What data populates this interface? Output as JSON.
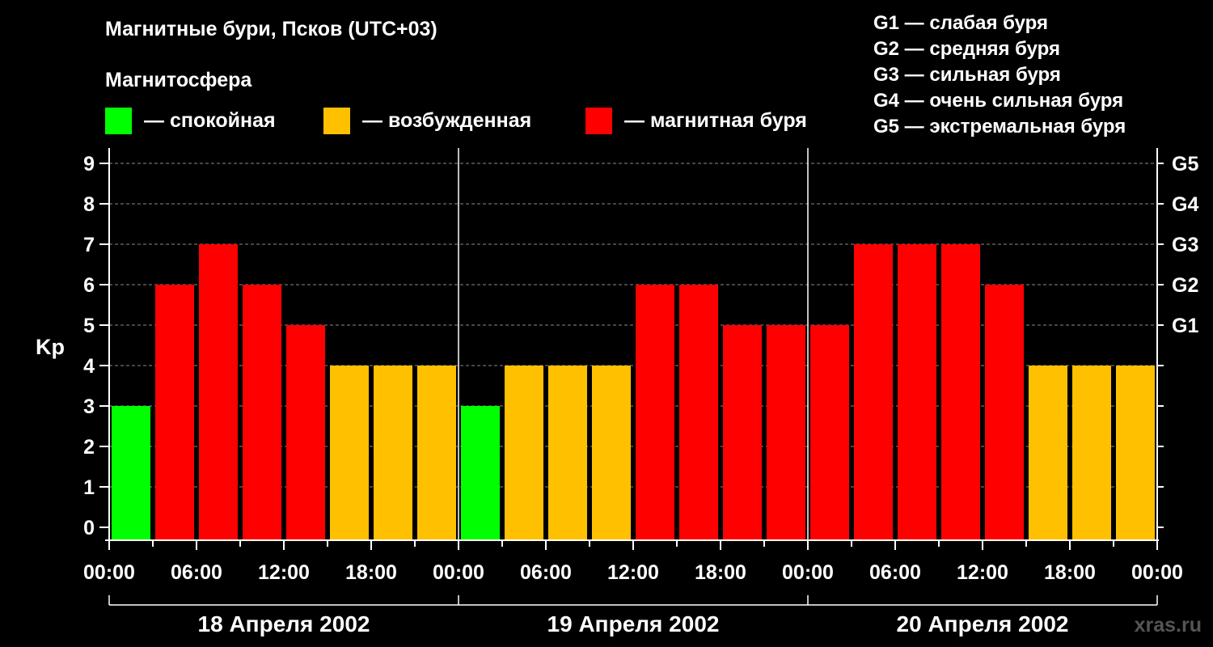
{
  "title": "Магнитные бури, Псков (UTC+03)",
  "subtitle": "Магнитосфера",
  "legend": [
    {
      "label": "— спокойная",
      "color": "#00ff00"
    },
    {
      "label": "— возбужденная",
      "color": "#ffc000"
    },
    {
      "label": "— магнитная буря",
      "color": "#ff0000"
    }
  ],
  "g_legend": [
    "G1 — слабая буря",
    "G2 — средняя буря",
    "G3 — сильная буря",
    "G4 — очень сильная буря",
    "G5 — экстремальная буря"
  ],
  "watermark": "xras.ru",
  "chart_data": {
    "type": "bar",
    "ylabel": "Kp",
    "ylim": [
      0,
      9
    ],
    "yticks": [
      0,
      1,
      2,
      3,
      4,
      5,
      6,
      7,
      8,
      9
    ],
    "right_ticks": [
      {
        "value": 5,
        "label": "G1"
      },
      {
        "value": 6,
        "label": "G2"
      },
      {
        "value": 7,
        "label": "G3"
      },
      {
        "value": 8,
        "label": "G4"
      },
      {
        "value": 9,
        "label": "G5"
      }
    ],
    "grid": "dashed horizontal",
    "xtick_labels": [
      "00:00",
      "06:00",
      "12:00",
      "18:00",
      "00:00",
      "06:00",
      "12:00",
      "18:00",
      "00:00",
      "06:00",
      "12:00",
      "18:00",
      "00:00"
    ],
    "days": [
      "18 Апреля 2002",
      "19 Апреля 2002",
      "20 Апреля 2002"
    ],
    "values": [
      3,
      6,
      7,
      6,
      5,
      4,
      4,
      4,
      3,
      4,
      4,
      4,
      6,
      6,
      5,
      5,
      5,
      7,
      7,
      7,
      6,
      4,
      4,
      4
    ],
    "colors": {
      "quiet": "#00ff00",
      "active": "#ffc000",
      "storm": "#ff0000"
    }
  }
}
